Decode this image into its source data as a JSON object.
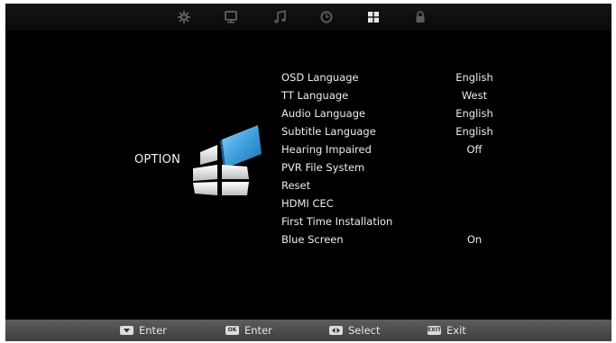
{
  "tabs": [
    {
      "icon": "gear-icon",
      "active": false
    },
    {
      "icon": "monitor-icon",
      "active": false
    },
    {
      "icon": "music-note-icon",
      "active": false
    },
    {
      "icon": "clock-icon",
      "active": false
    },
    {
      "icon": "grid-option-icon",
      "active": true
    },
    {
      "icon": "lock-icon",
      "active": false
    }
  ],
  "category": {
    "title": "OPTION",
    "icon": "option-blocks-icon"
  },
  "menu": [
    {
      "label": "OSD Language",
      "value": "English"
    },
    {
      "label": "TT Language",
      "value": "West"
    },
    {
      "label": "Audio Language",
      "value": "English"
    },
    {
      "label": "Subtitle Language",
      "value": "English"
    },
    {
      "label": "Hearing Impaired",
      "value": "Off"
    },
    {
      "label": "PVR File System",
      "value": ""
    },
    {
      "label": "Reset",
      "value": ""
    },
    {
      "label": "HDMI CEC",
      "value": ""
    },
    {
      "label": "First Time Installation",
      "value": ""
    },
    {
      "label": "Blue Screen",
      "value": "On"
    }
  ],
  "footer": [
    {
      "key": "down-arrow-key-icon",
      "key_text": "",
      "label": "Enter"
    },
    {
      "key": "ok-key-icon",
      "key_text": "OK",
      "label": "Enter"
    },
    {
      "key": "left-right-key-icon",
      "key_text": "",
      "label": "Select"
    },
    {
      "key": "exit-key-icon",
      "key_text": "EXIT",
      "label": "Exit"
    }
  ],
  "colors": {
    "background": "#000000",
    "text": "#ececec",
    "icon_dim": "#5a5a5a",
    "icon_active": "#e8e8e8",
    "logo_blue": "#3fa0de",
    "footer": "#4a4a4a"
  }
}
